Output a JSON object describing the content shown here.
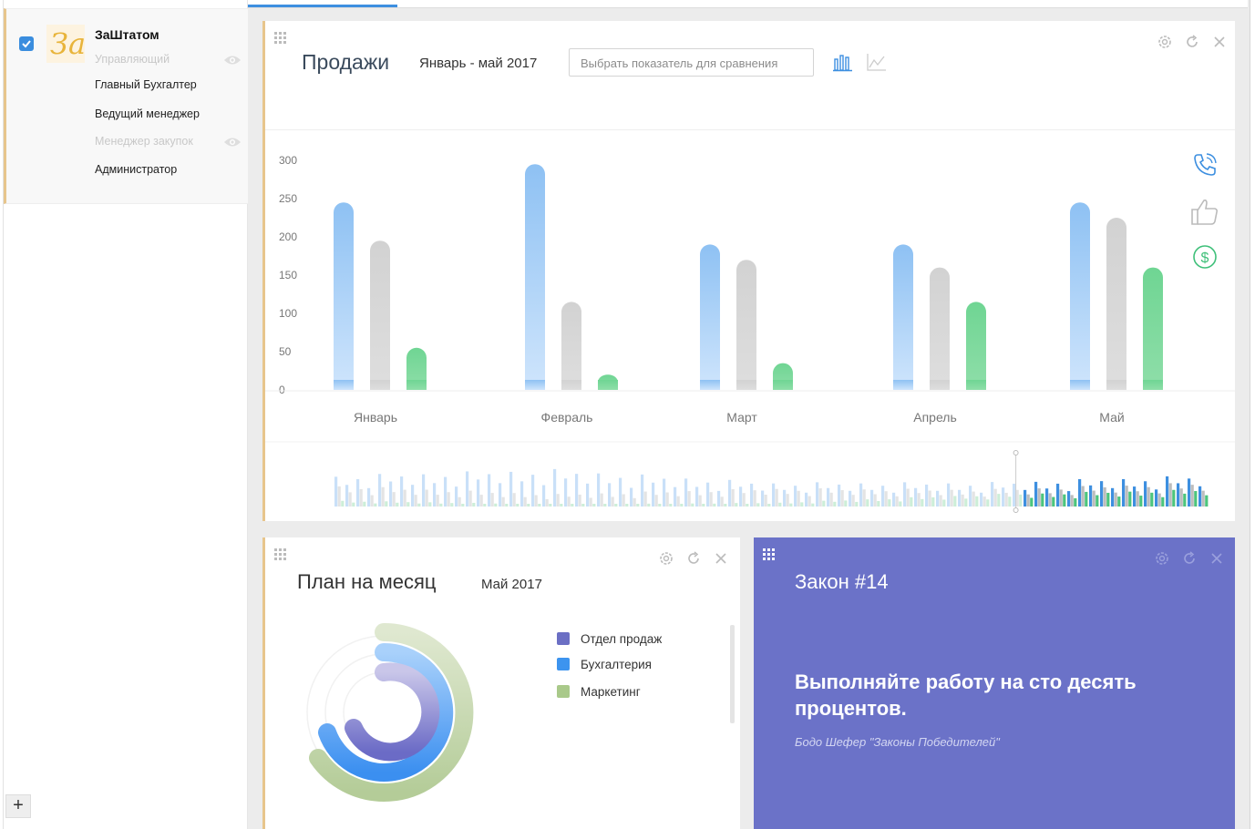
{
  "sidebar": {
    "company": "ЗаШтатом",
    "logo_text": "За",
    "roles": [
      {
        "label": "Управляющий",
        "dimmed": true,
        "eye": true
      },
      {
        "label": "Главный Бухгалтер",
        "dimmed": false,
        "eye": false
      },
      {
        "label": "Ведущий менеджер",
        "dimmed": false,
        "eye": false
      },
      {
        "label": "Менеджер закупок",
        "dimmed": true,
        "eye": true
      },
      {
        "label": "Администратор",
        "dimmed": false,
        "eye": false
      }
    ],
    "add_label": "+"
  },
  "sales": {
    "title": "Продажи",
    "period": "Январь - май 2017",
    "compare_placeholder": "Выбрать показатель для сравнения",
    "side_icons": [
      "phone-icon",
      "thumbs-up-icon",
      "dollar-icon"
    ],
    "chart_view_icons": [
      "bar-chart-icon",
      "line-chart-icon"
    ]
  },
  "chart_data": {
    "type": "bar",
    "categories": [
      "Январь",
      "Февраль",
      "Март",
      "Апрель",
      "Май"
    ],
    "series": [
      {
        "values": [
          245,
          295,
          190,
          190,
          245
        ],
        "color": "#9cc9f5"
      },
      {
        "values": [
          195,
          115,
          170,
          160,
          225
        ],
        "color": "#d6d6d6"
      },
      {
        "values": [
          55,
          20,
          35,
          115,
          160
        ],
        "color": "#7bd89d"
      }
    ],
    "yticks": [
      0,
      50,
      100,
      150,
      200,
      250,
      300
    ],
    "ylim": [
      0,
      300
    ],
    "grid": false
  },
  "plan": {
    "title": "План на месяц",
    "period": "Май 2017",
    "legend": [
      {
        "label": "Отдел продаж",
        "color": "#6b6fc4"
      },
      {
        "label": "Бухгалтерия",
        "color": "#3d94ef"
      },
      {
        "label": "Маркетинг",
        "color": "#a9c98a"
      }
    ]
  },
  "law": {
    "title": "Закон #14",
    "quote": "Выполняйте работу на сто десять процентов.",
    "author": "Бодо Шефер \"Законы Победителей\""
  }
}
